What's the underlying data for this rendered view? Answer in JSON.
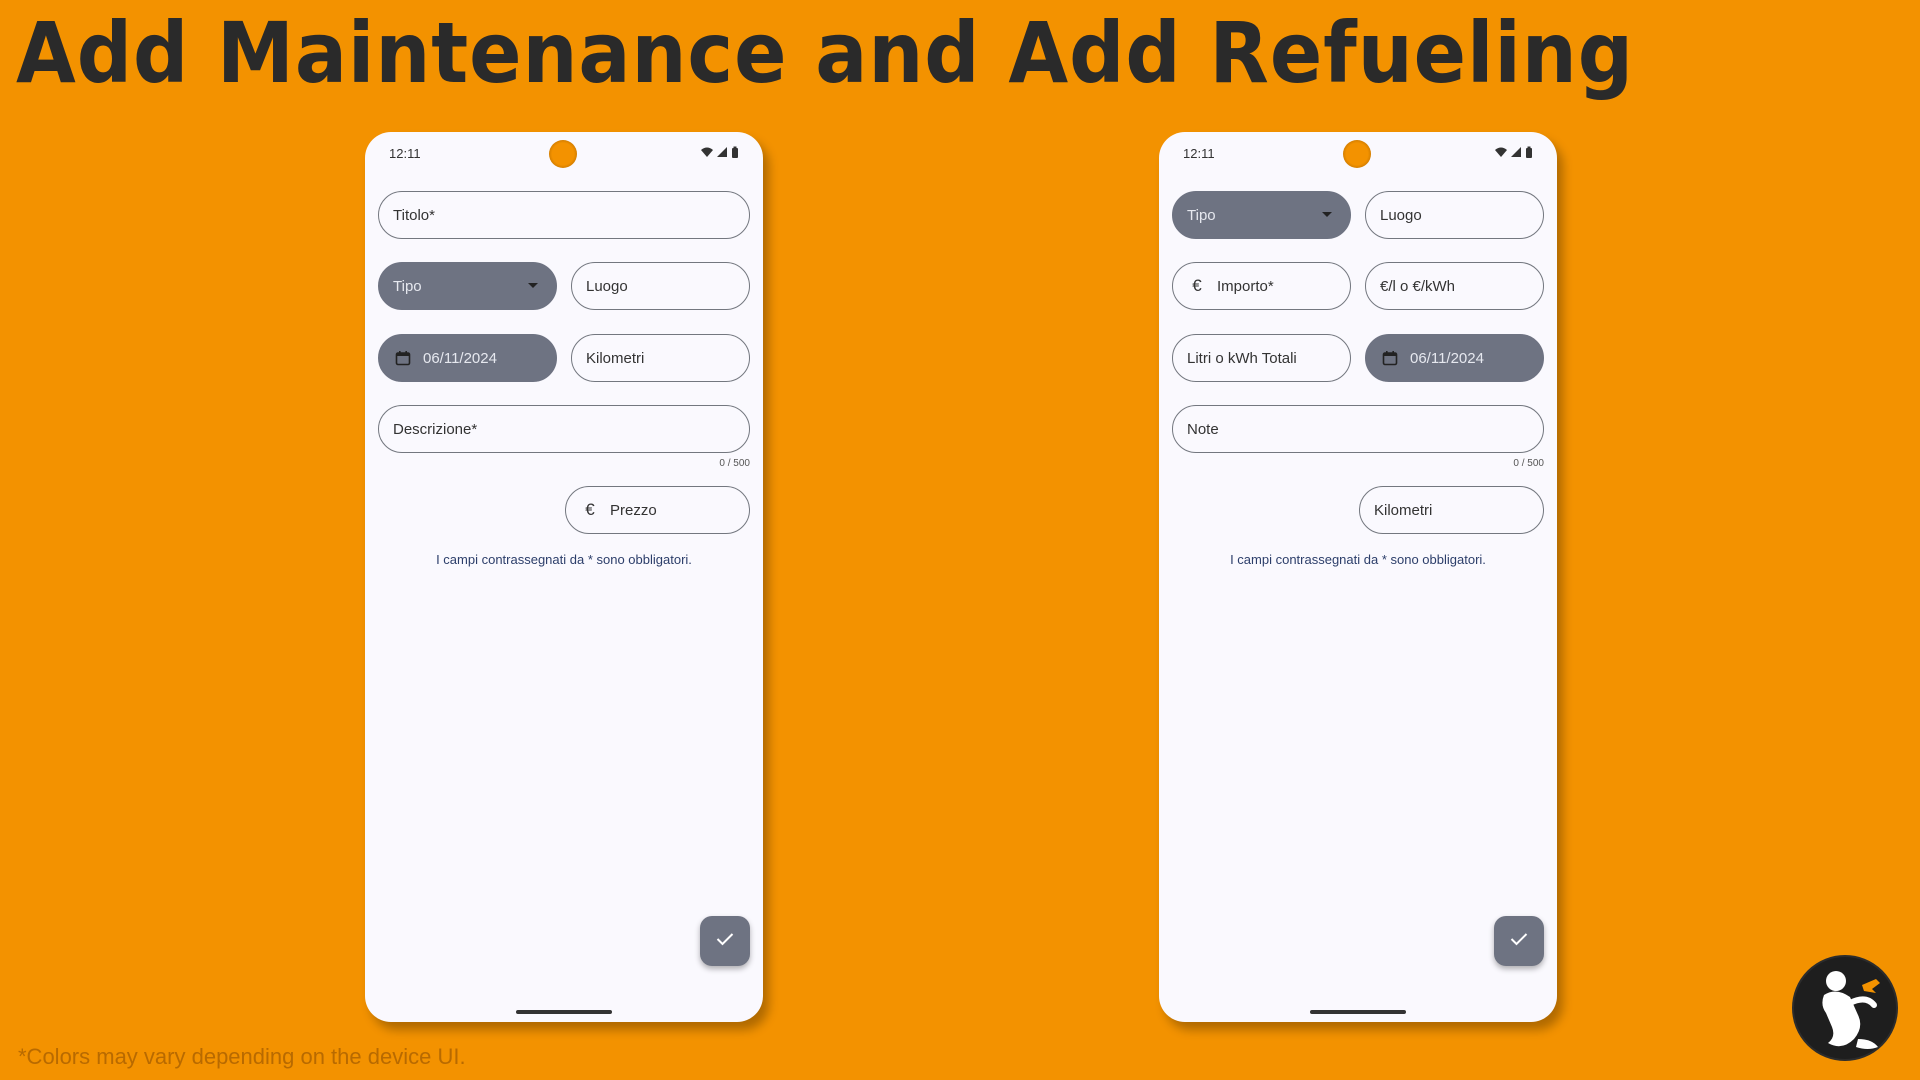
{
  "title": "Add Maintenance and Add Refueling",
  "footnote": "*Colors may vary depending on the device UI.",
  "colors": {
    "background": "#F39200",
    "filled_field": "#6E7382",
    "screen": "#FAF9FE"
  },
  "maintenance": {
    "status_time": "12:11",
    "titolo_placeholder": "Titolo*",
    "tipo_label": "Tipo",
    "luogo_placeholder": "Luogo",
    "date_value": "06/11/2024",
    "kilometri_placeholder": "Kilometri",
    "descrizione_placeholder": "Descrizione*",
    "counter": "0 / 500",
    "prezzo_placeholder": "Prezzo",
    "currency_icon": "€",
    "hint": "I campi contrassegnati da * sono obbligatori."
  },
  "refueling": {
    "status_time": "12:11",
    "tipo_label": "Tipo",
    "luogo_placeholder": "Luogo",
    "importo_placeholder": "Importo*",
    "currency_icon": "€",
    "unit_price_placeholder": "€/l o €/kWh",
    "totale_placeholder": "Litri o kWh Totali",
    "date_value": "06/11/2024",
    "note_placeholder": "Note",
    "counter": "0 / 500",
    "kilometri_placeholder": "Kilometri",
    "hint": "I campi contrassegnati da * sono obbligatori."
  }
}
